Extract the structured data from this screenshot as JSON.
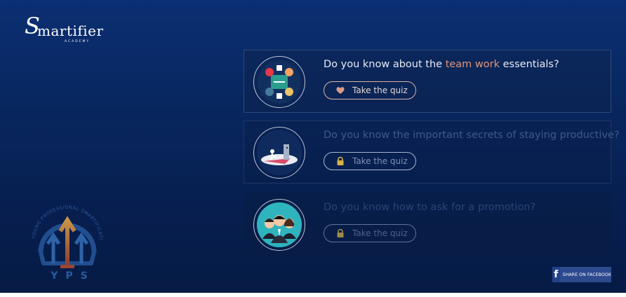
{
  "brand": {
    "logo_word": "martifier",
    "logo_sub": "ACADEMY"
  },
  "badge": {
    "ring_text": "YOUNG PROFESSIONAL SMARTIFICATION",
    "letters": "YPS"
  },
  "quizzes": [
    {
      "question_prefix": "Do you know about the ",
      "question_highlight": "team work",
      "question_suffix": " essentials?",
      "button_label": "Take the quiz",
      "state": "open"
    },
    {
      "question": "Do you know the important secrets of staying productive?",
      "button_label": "Take the quiz",
      "state": "locked"
    },
    {
      "question": "Do you know how to ask for a promotion?",
      "button_label": "Take the quiz",
      "state": "locked"
    }
  ],
  "share": {
    "label": "SHARE ON FACEBOOK"
  },
  "colors": {
    "background_top": "#0b2f73",
    "background_bottom": "#061b45",
    "highlight": "#e0957a",
    "heart": "#d99b8a",
    "lock": "#d8b14a",
    "facebook": "#2d4a8e"
  },
  "icons": {
    "open_quiz": "heart-icon",
    "locked_quiz": "lock-icon",
    "share": "facebook-icon"
  }
}
